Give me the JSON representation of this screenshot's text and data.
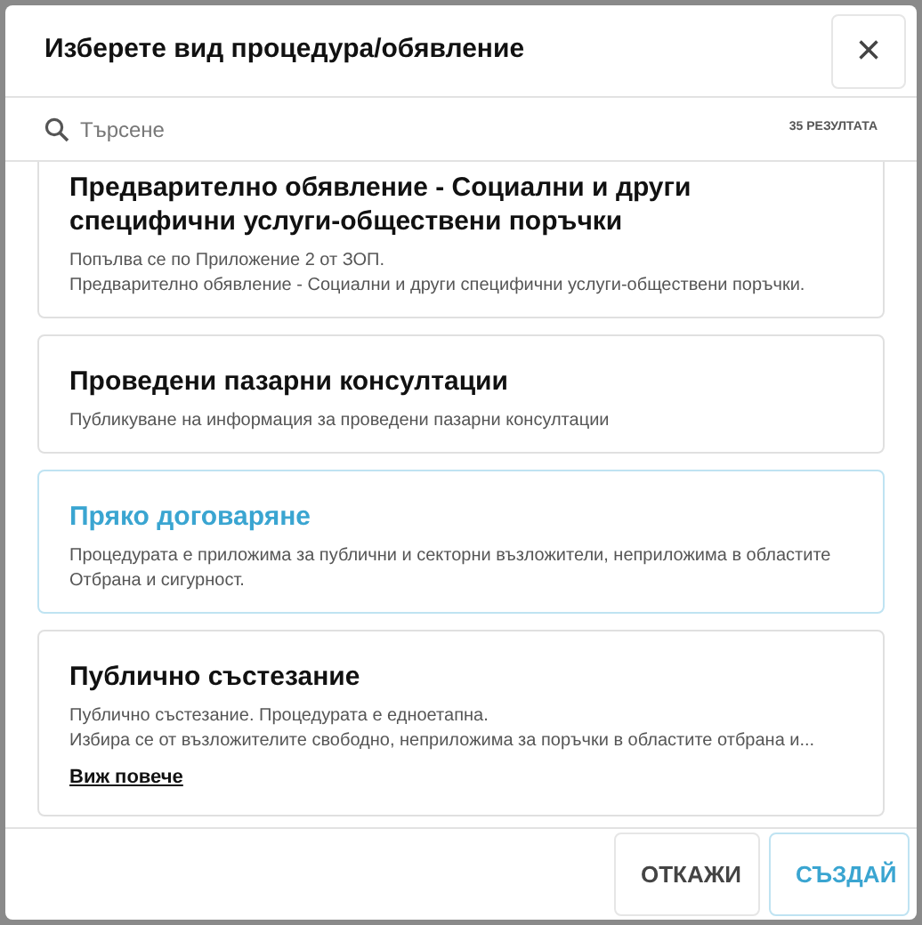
{
  "dialog": {
    "title": "Изберете вид процедура/обявление",
    "close_label": "×"
  },
  "search": {
    "placeholder": "Търсене",
    "results": "35 РЕЗУЛТАТА"
  },
  "options": [
    {
      "title": "Предварително обявление - Социални и други специфични услуги-обществени поръчки",
      "lines": [
        "Попълва се по Приложение 2 от ЗОП.",
        "Предварително обявление - Социални и други специфични услуги-обществени поръчки."
      ],
      "selected": false
    },
    {
      "title": "Проведени пазарни консултации",
      "lines": [
        "Публикуване на информация за проведени пазарни консултации"
      ],
      "selected": false
    },
    {
      "title": "Пряко договаряне",
      "lines": [
        "Процедурата е приложима за публични и секторни възложители,  неприложима в областите Отбрана и сигурност."
      ],
      "selected": true
    },
    {
      "title": "Публично състезание",
      "lines": [
        "Публично състезание.  Процедурата е едноетапна.",
        "Избира се от възложителите свободно, неприложима за поръчки в областите отбрана и..."
      ],
      "more_link": "Виж повече",
      "selected": false
    }
  ],
  "buttons": [
    {
      "label": "ОТКАЖИ",
      "kind": "secondary"
    },
    {
      "label": "СЪЗДАЙ",
      "kind": "primary"
    }
  ]
}
